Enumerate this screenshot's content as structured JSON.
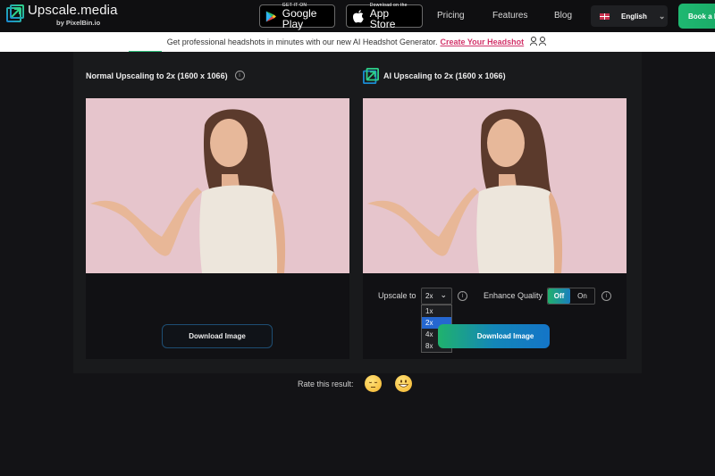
{
  "header": {
    "brand_name": "Upscale.media",
    "brand_sub": "by PixelBin.io",
    "google_play": {
      "small": "GET IT ON",
      "big": "Google Play"
    },
    "app_store": {
      "small": "Download on the",
      "big": "App Store"
    },
    "nav": [
      "Pricing",
      "Features",
      "Blog"
    ],
    "language": "English",
    "cta": "Book a Demo"
  },
  "banner": {
    "text": "Get professional headshots in minutes with our new AI Headshot Generator.",
    "link": "Create Your Headshot",
    "icons": "👩‍💼👤"
  },
  "left_panel": {
    "title": "Normal Upscaling to 2x (1600 x 1066)",
    "download_label": "Download Image"
  },
  "right_panel": {
    "title": "AI Upscaling to 2x (1600 x 1066)",
    "upscale_label": "Upscale to",
    "upscale_value": "2x",
    "upscale_options": [
      "1x",
      "2x",
      "4x",
      "8x"
    ],
    "enhance_label": "Enhance Quality",
    "toggle_off": "Off",
    "toggle_on": "On",
    "download_label": "Download Image"
  },
  "rating": {
    "label": "Rate this result:"
  },
  "colors": {
    "accent_green": "#1fb871",
    "accent_blue": "#1475c8",
    "link_pink": "#d2346a"
  }
}
